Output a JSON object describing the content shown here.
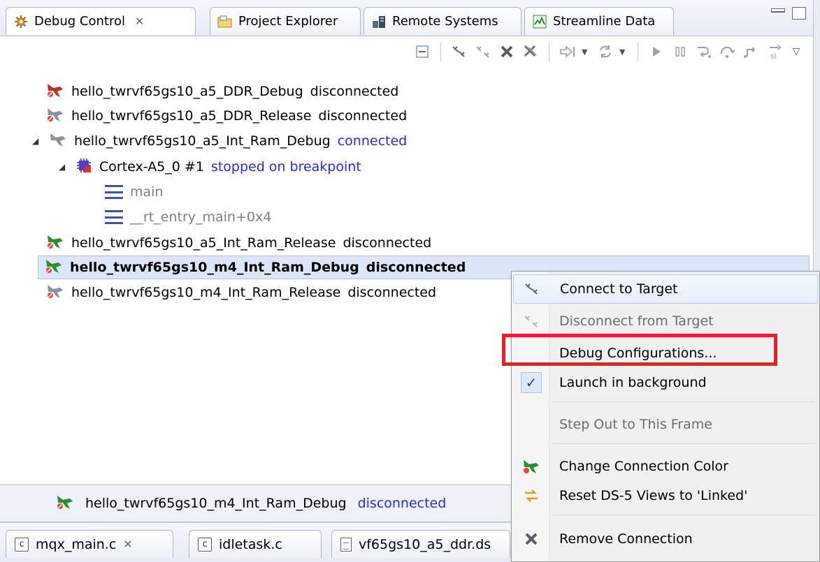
{
  "tabs": [
    {
      "label": "Debug Control",
      "icon": "debug-control-icon",
      "active": true
    },
    {
      "label": "Project Explorer",
      "icon": "folder-icon"
    },
    {
      "label": "Remote Systems",
      "icon": "remote-systems-icon"
    },
    {
      "label": "Streamline Data",
      "icon": "streamline-icon"
    }
  ],
  "tree": {
    "rows": [
      {
        "label": "hello_twrvf65gs10_a5_DDR_Debug",
        "status": "disconnected"
      },
      {
        "label": "hello_twrvf65gs10_a5_DDR_Release",
        "status": "disconnected"
      },
      {
        "label": "hello_twrvf65gs10_a5_Int_Ram_Debug",
        "status": "connected"
      },
      {
        "label": "Cortex-A5_0 #1",
        "status": "stopped on breakpoint"
      },
      {
        "label": "main"
      },
      {
        "label": "__rt_entry_main+0x4"
      },
      {
        "label": "hello_twrvf65gs10_a5_Int_Ram_Release",
        "status": "disconnected"
      },
      {
        "label": "hello_twrvf65gs10_m4_Int_Ram_Debug",
        "status": "disconnected"
      },
      {
        "label": "hello_twrvf65gs10_m4_Int_Ram_Release",
        "status": "disconnected"
      }
    ]
  },
  "status_line": {
    "label": "hello_twrvf65gs10_m4_Int_Ram_Debug",
    "status": "disconnected"
  },
  "editor_tabs": [
    {
      "label": "mqx_main.c",
      "icon": "c-file-icon",
      "closable": true
    },
    {
      "label": "idletask.c",
      "icon": "c-file-icon"
    },
    {
      "label": "vf65gs10_a5_ddr.ds",
      "icon": "ds-file-icon"
    }
  ],
  "menu": {
    "items": [
      {
        "label": "Connect to Target",
        "icon": "connect-icon"
      },
      {
        "label": "Disconnect from Target",
        "icon": "disconnect-icon",
        "disabled": true
      },
      {
        "label": "Debug Configurations..."
      },
      {
        "label": "Launch in background",
        "checked": true
      },
      {
        "label": "Step Out to This Frame",
        "disabled": true
      },
      {
        "label": "Change Connection Color",
        "icon": "connection-color-icon"
      },
      {
        "label": "Reset DS-5 Views to 'Linked'",
        "icon": "link-views-icon"
      },
      {
        "label": "Remove Connection",
        "icon": "remove-icon"
      }
    ]
  },
  "colors": {
    "status_blue": "#2a2ae0",
    "highlight_red": "#e8202a",
    "selection_bg": "#dbe7f7"
  }
}
